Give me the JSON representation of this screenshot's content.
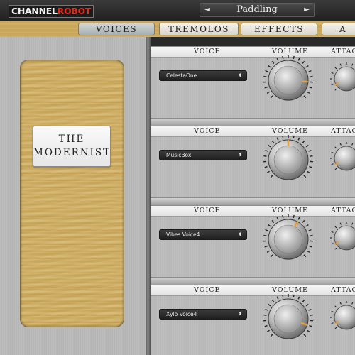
{
  "header": {
    "logo_part1": "CHANNEL",
    "logo_part2": "ROBOT",
    "preset_name": "Paddling",
    "prev_arrow": "◄",
    "next_arrow": "►"
  },
  "tabs": [
    {
      "label": "VOICES",
      "active": true
    },
    {
      "label": "TREMOLOS",
      "active": false
    },
    {
      "label": "EFFECTS",
      "active": false
    },
    {
      "label": "A",
      "active": false
    }
  ],
  "instrument": {
    "name_line1": "THE",
    "name_line2": "MODERNIST"
  },
  "columns": {
    "voice": "VOICE",
    "volume": "VOLUME",
    "attack": "ATTAC"
  },
  "voices": [
    {
      "voice": "CelestaOne",
      "volume": 0.85
    },
    {
      "voice": "MusicBox",
      "volume": 0.5
    },
    {
      "voice": "Vibes Voice4",
      "volume": 0.6
    },
    {
      "voice": "Xylo Voice4",
      "volume": 0.9
    }
  ],
  "colors": {
    "accent": "#e8a23a",
    "logo_red": "#e12d20"
  },
  "icons": {
    "select_arrows": "⬍"
  }
}
